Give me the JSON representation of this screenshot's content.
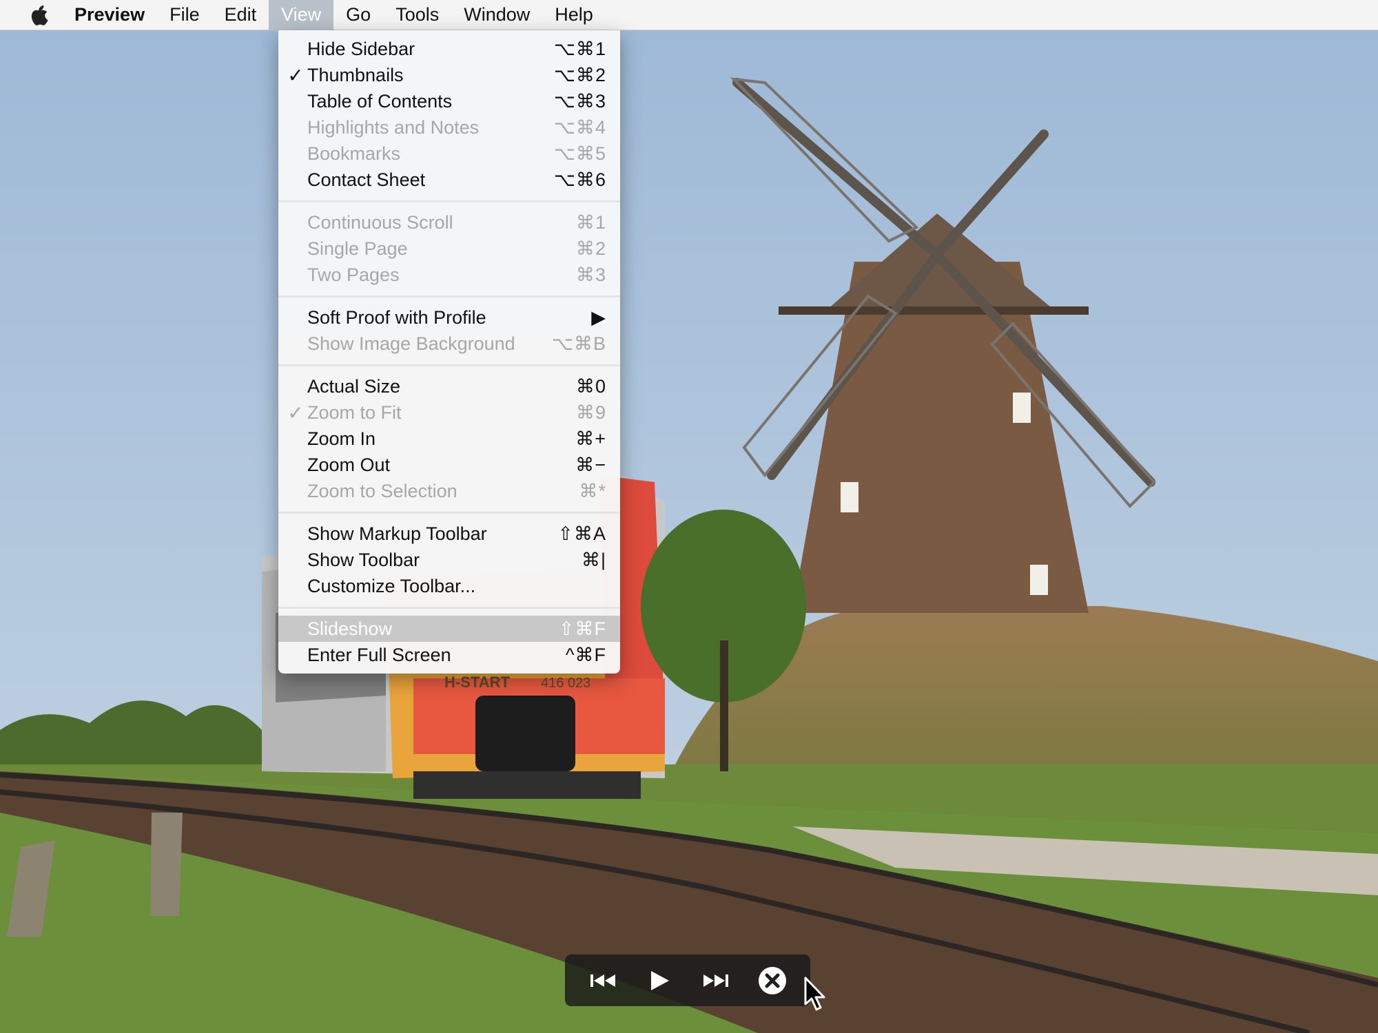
{
  "menubar": {
    "app_name": "Preview",
    "items": [
      "File",
      "Edit",
      "View",
      "Go",
      "Tools",
      "Window",
      "Help"
    ],
    "active_item": "View"
  },
  "view_menu": {
    "groups": [
      [
        {
          "label": "Hide Sidebar",
          "shortcut": "⌥⌘1",
          "enabled": true,
          "checked": false
        },
        {
          "label": "Thumbnails",
          "shortcut": "⌥⌘2",
          "enabled": true,
          "checked": true
        },
        {
          "label": "Table of Contents",
          "shortcut": "⌥⌘3",
          "enabled": true,
          "checked": false
        },
        {
          "label": "Highlights and Notes",
          "shortcut": "⌥⌘4",
          "enabled": false,
          "checked": false
        },
        {
          "label": "Bookmarks",
          "shortcut": "⌥⌘5",
          "enabled": false,
          "checked": false
        },
        {
          "label": "Contact Sheet",
          "shortcut": "⌥⌘6",
          "enabled": true,
          "checked": false
        }
      ],
      [
        {
          "label": "Continuous Scroll",
          "shortcut": "⌘1",
          "enabled": false,
          "checked": false
        },
        {
          "label": "Single Page",
          "shortcut": "⌘2",
          "enabled": false,
          "checked": false
        },
        {
          "label": "Two Pages",
          "shortcut": "⌘3",
          "enabled": false,
          "checked": false
        }
      ],
      [
        {
          "label": "Soft Proof with Profile",
          "shortcut": "▶",
          "enabled": true,
          "checked": false
        },
        {
          "label": "Show Image Background",
          "shortcut": "⌥⌘B",
          "enabled": false,
          "checked": false
        }
      ],
      [
        {
          "label": "Actual Size",
          "shortcut": "⌘0",
          "enabled": true,
          "checked": false
        },
        {
          "label": "Zoom to Fit",
          "shortcut": "⌘9",
          "enabled": false,
          "checked": true
        },
        {
          "label": "Zoom In",
          "shortcut": "⌘+",
          "enabled": true,
          "checked": false
        },
        {
          "label": "Zoom Out",
          "shortcut": "⌘−",
          "enabled": true,
          "checked": false
        },
        {
          "label": "Zoom to Selection",
          "shortcut": "⌘*",
          "enabled": false,
          "checked": false
        }
      ],
      [
        {
          "label": "Show Markup Toolbar",
          "shortcut": "⇧⌘A",
          "enabled": true,
          "checked": false
        },
        {
          "label": "Show Toolbar",
          "shortcut": "⌘|",
          "enabled": true,
          "checked": false
        },
        {
          "label": "Customize Toolbar...",
          "shortcut": "",
          "enabled": true,
          "checked": false
        }
      ],
      [
        {
          "label": "Slideshow",
          "shortcut": "⇧⌘F",
          "enabled": true,
          "checked": false,
          "highlighted": true
        },
        {
          "label": "Enter Full Screen",
          "shortcut": "^⌘F",
          "enabled": true,
          "checked": false
        }
      ]
    ]
  },
  "photo_signage": {
    "train_sign": "H-START",
    "train_number": "416 023"
  },
  "slideshow_controls": {
    "buttons": [
      "previous-icon",
      "play-icon",
      "next-icon",
      "close-icon"
    ]
  },
  "colors": {
    "menu_highlight": "#c8c8c8",
    "active_menu": "#b8c1c9",
    "disabled_text": "#a7a7a7"
  }
}
